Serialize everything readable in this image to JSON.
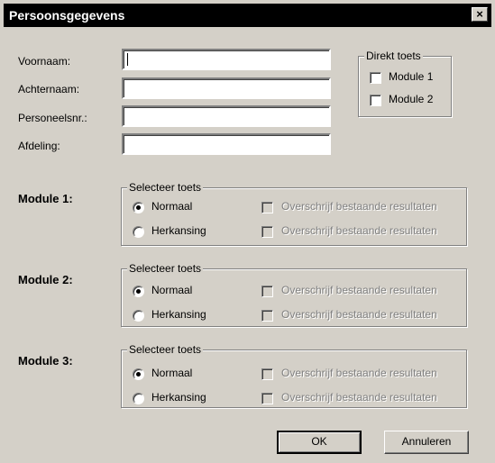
{
  "window": {
    "title": "Persoonsgegevens",
    "close_glyph": "×"
  },
  "fields": [
    {
      "label": "Voornaam:",
      "value": ""
    },
    {
      "label": "Achternaam:",
      "value": ""
    },
    {
      "label": "Personeelsnr.:",
      "value": ""
    },
    {
      "label": "Afdeling:",
      "value": ""
    }
  ],
  "direkt": {
    "legend": "Direkt toets",
    "items": [
      {
        "label": "Module 1",
        "checked": false
      },
      {
        "label": "Module 2",
        "checked": false
      }
    ]
  },
  "modules": [
    {
      "title": "Module 1:",
      "group": "Selecteer toets",
      "opt_normal": "Normaal",
      "opt_retake": "Herkansing",
      "overwrite": "Overschrijf bestaande resultaten",
      "selected": "normal"
    },
    {
      "title": "Module 2:",
      "group": "Selecteer toets",
      "opt_normal": "Normaal",
      "opt_retake": "Herkansing",
      "overwrite": "Overschrijf bestaande resultaten",
      "selected": "normal"
    },
    {
      "title": "Module 3:",
      "group": "Selecteer toets",
      "opt_normal": "Normaal",
      "opt_retake": "Herkansing",
      "overwrite": "Overschrijf bestaande resultaten",
      "selected": "normal"
    }
  ],
  "buttons": {
    "ok": "OK",
    "cancel": "Annuleren"
  }
}
